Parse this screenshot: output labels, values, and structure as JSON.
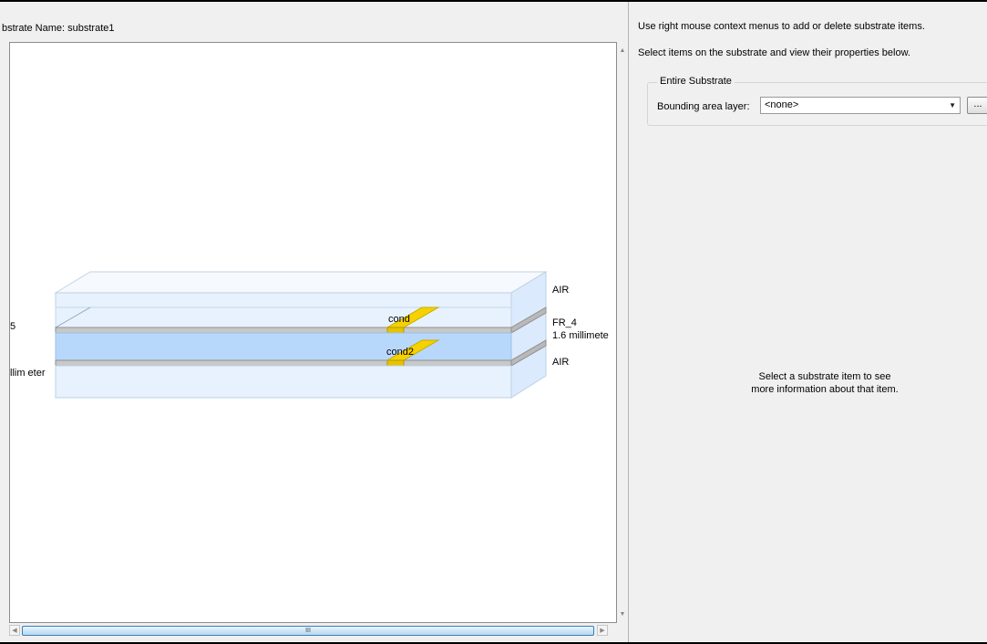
{
  "left_pane": {
    "title": "bstrate Name:  substrate1",
    "cut_label_top": "5",
    "cut_label_bottom": "llim eter",
    "hscroll_thumb_label": "III"
  },
  "layers": {
    "top_label": "AIR",
    "middle_label": "FR_4",
    "middle_thickness": "1.6 millimete",
    "bottom_label": "AIR",
    "cond1_label": "cond",
    "cond2_label": "cond2"
  },
  "right_pane": {
    "hint1": "Use right mouse context menus to add or delete substrate items.",
    "hint2": "Select items on the substrate and view their properties below.",
    "group_title": "Entire Substrate",
    "bounding_label": "Bounding area layer:",
    "bounding_value": "<none>",
    "browse_label": "...",
    "info_line1": "Select a substrate item to see",
    "info_line2": "more information about that item."
  },
  "colors": {
    "air": "#e8f2fe",
    "fr4": "#b8d8fb",
    "conductor": "#f5d200",
    "metal": "#c8c8c8"
  }
}
